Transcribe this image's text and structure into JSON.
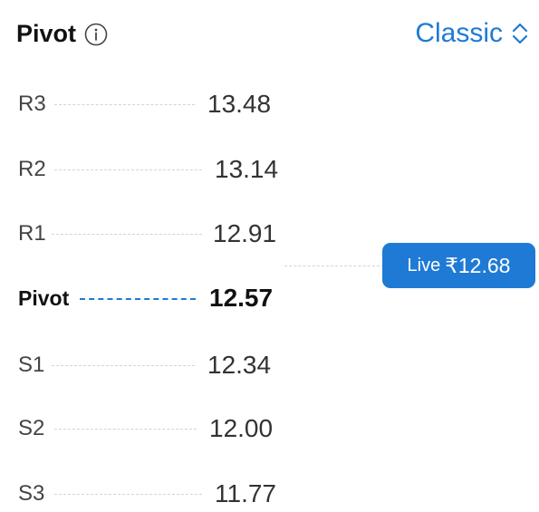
{
  "header": {
    "title": "Pivot",
    "mode": "Classic",
    "icons": {
      "info": "info-icon",
      "selector": "chevron-up-down-icon"
    }
  },
  "levels": [
    {
      "label": "R3",
      "value": "13.48"
    },
    {
      "label": "R2",
      "value": "13.14"
    },
    {
      "label": "R1",
      "value": "12.91"
    },
    {
      "label": "Pivot",
      "value": "12.57"
    },
    {
      "label": "S1",
      "value": "12.34"
    },
    {
      "label": "S2",
      "value": "12.00"
    },
    {
      "label": "S3",
      "value": "11.77"
    }
  ],
  "live": {
    "label": "Live",
    "price": "₹12.68"
  },
  "colors": {
    "accent": "#1f7ad6",
    "text": "#111111",
    "muted": "#444444",
    "dash": "#d4d4d4"
  }
}
